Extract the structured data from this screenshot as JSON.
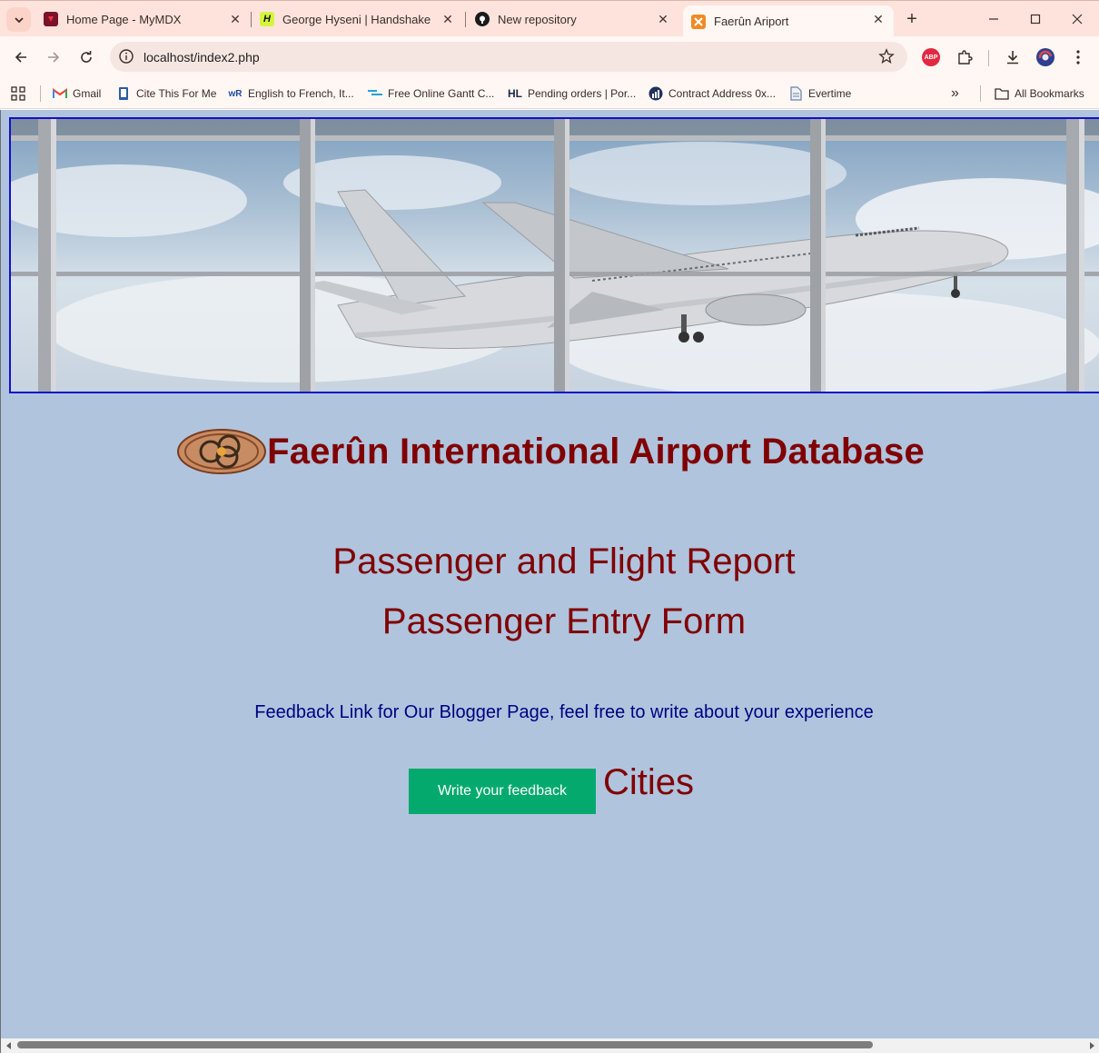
{
  "browser": {
    "tabs": [
      {
        "title": "Home Page - MyMDX",
        "icon": "mymdx-icon",
        "active": false
      },
      {
        "title": "George Hyseni | Handshake",
        "icon": "handshake-icon",
        "active": false
      },
      {
        "title": "New repository",
        "icon": "github-icon",
        "active": false
      },
      {
        "title": "Faerûn Ariport",
        "icon": "xampp-icon",
        "active": true
      }
    ],
    "new_tab_symbol": "+",
    "close_symbol": "✕",
    "address": "localhost/index2.php",
    "extension_abp": "ABP",
    "bookmarks": [
      {
        "label": "Gmail",
        "icon": "gmail-icon"
      },
      {
        "label": "Cite This For Me",
        "icon": "cite-this-icon"
      },
      {
        "label": "English to French, It...",
        "icon": "wordreference-icon"
      },
      {
        "label": "Free Online Gantt C...",
        "icon": "gantt-icon"
      },
      {
        "label": "Pending orders | Por...",
        "icon": "hl-icon"
      },
      {
        "label": "Contract Address 0x...",
        "icon": "etherscan-icon"
      },
      {
        "label": "Evertime",
        "icon": "document-icon"
      }
    ],
    "bookmarks_overflow": "»",
    "all_bookmarks_label": "All Bookmarks",
    "hl_icon_text": "HL",
    "wr_icon_text": "wR"
  },
  "page": {
    "main_title": "Faerûn International Airport Database",
    "subtitle_report": "Passenger and Flight Report",
    "subtitle_form": "Passenger Entry Form",
    "feedback_text": "Feedback Link for Our Blogger Page, feel free to write about your experience",
    "feedback_button": "Write your feedback",
    "cities_link": "Cities"
  },
  "colors": {
    "page_background": "#b0c4de",
    "title_color": "#800000",
    "link_color": "#000080",
    "button_color": "#04aa6d",
    "banner_border": "#1510c8"
  }
}
